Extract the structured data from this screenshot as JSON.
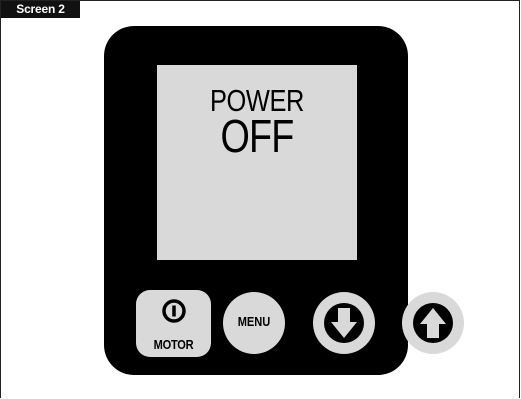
{
  "screen_label": "Screen 2",
  "display": {
    "line1": "POWER",
    "line2": "OFF"
  },
  "buttons": {
    "motor": {
      "label": "MOTOR",
      "icon": "power-icon"
    },
    "menu": {
      "label": "MENU"
    },
    "down": {
      "icon": "arrow-down-icon"
    },
    "up": {
      "icon": "arrow-up-icon"
    }
  },
  "colors": {
    "device_body": "#000000",
    "lcd_background": "#d9d9d9",
    "button_face": "#d9d9d9",
    "label_background": "#111111"
  }
}
